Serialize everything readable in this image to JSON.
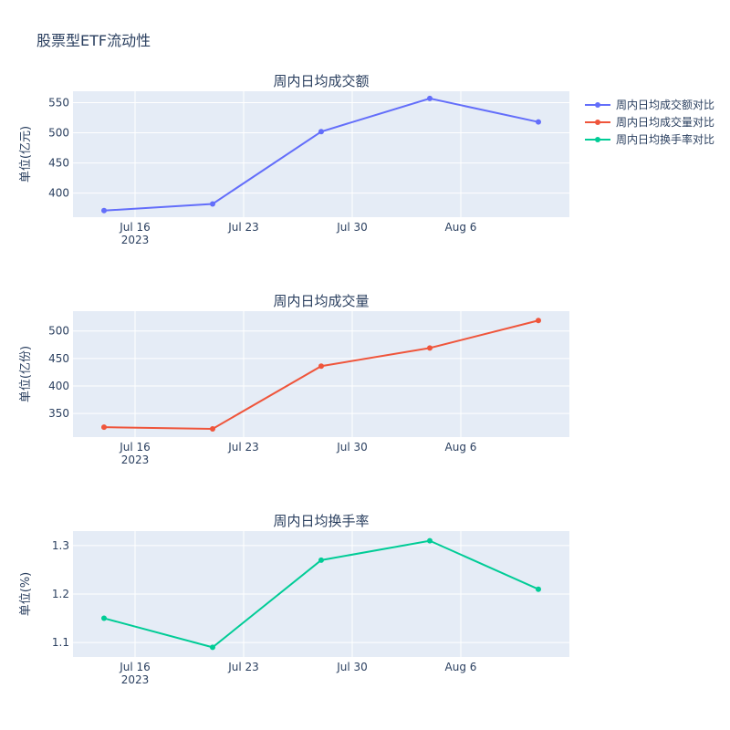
{
  "figure_title": "股票型ETF流动性",
  "colors": {
    "amount": "#636efa",
    "volume": "#ef553b",
    "turnover": "#00cc96"
  },
  "chart_data": [
    {
      "type": "line",
      "title": "周内日均成交额",
      "ylabel": "单位(亿元)",
      "xlabel": "",
      "x": [
        "2023-07-14",
        "2023-07-21",
        "2023-07-28",
        "2023-08-04",
        "2023-08-11"
      ],
      "xlim": [
        "2023-07-12",
        "2023-08-13"
      ],
      "ylim": [
        360,
        569
      ],
      "yticks": [
        400,
        450,
        500,
        550
      ],
      "series": [
        {
          "name": "周内日均成交额对比",
          "values": [
            371,
            382,
            502,
            557,
            518
          ],
          "color": "#636efa"
        }
      ]
    },
    {
      "type": "line",
      "title": "周内日均成交量",
      "ylabel": "单位(亿份)",
      "xlabel": "",
      "x": [
        "2023-07-14",
        "2023-07-21",
        "2023-07-28",
        "2023-08-04",
        "2023-08-11"
      ],
      "xlim": [
        "2023-07-12",
        "2023-08-13"
      ],
      "ylim": [
        307,
        536
      ],
      "yticks": [
        350,
        400,
        450,
        500
      ],
      "series": [
        {
          "name": "周内日均成交量对比",
          "values": [
            325,
            322,
            436,
            469,
            519
          ],
          "color": "#ef553b"
        }
      ]
    },
    {
      "type": "line",
      "title": "周内日均换手率",
      "ylabel": "单位(%)",
      "xlabel": "",
      "x": [
        "2023-07-14",
        "2023-07-21",
        "2023-07-28",
        "2023-08-04",
        "2023-08-11"
      ],
      "xlim": [
        "2023-07-12",
        "2023-08-13"
      ],
      "ylim": [
        1.07,
        1.33
      ],
      "yticks": [
        1.1,
        1.2,
        1.3
      ],
      "series": [
        {
          "name": "周内日均换手率对比",
          "values": [
            1.15,
            1.09,
            1.27,
            1.31,
            1.21
          ],
          "color": "#00cc96"
        }
      ]
    }
  ],
  "xticks": [
    {
      "date": "2023-07-16",
      "label": "Jul 16",
      "sublabel": "2023"
    },
    {
      "date": "2023-07-23",
      "label": "Jul 23",
      "sublabel": ""
    },
    {
      "date": "2023-07-30",
      "label": "Jul 30",
      "sublabel": ""
    },
    {
      "date": "2023-08-06",
      "label": "Aug 6",
      "sublabel": ""
    }
  ],
  "legend": {
    "position": "top-right",
    "items": [
      {
        "label": "周内日均成交额对比",
        "color": "#636efa"
      },
      {
        "label": "周内日均成交量对比",
        "color": "#ef553b"
      },
      {
        "label": "周内日均换手率对比",
        "color": "#00cc96"
      }
    ]
  }
}
